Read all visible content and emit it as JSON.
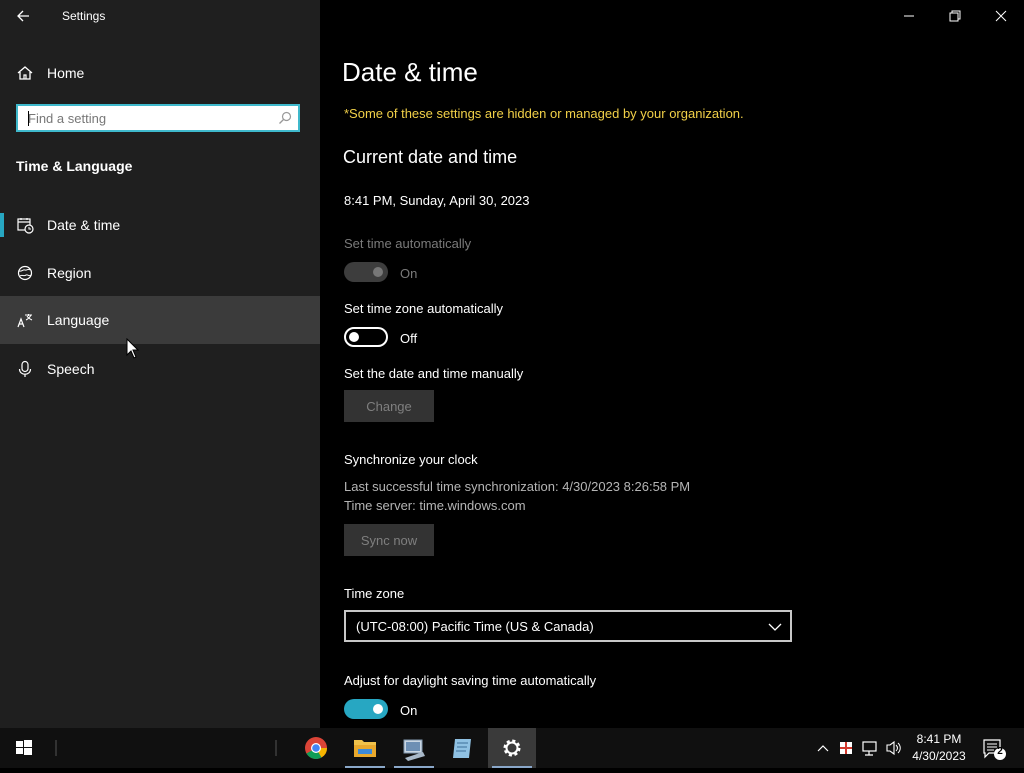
{
  "window": {
    "app_title": "Settings"
  },
  "sidebar": {
    "home_label": "Home",
    "search_placeholder": "Find a setting",
    "section_title": "Time & Language",
    "items": [
      {
        "label": "Date & time",
        "icon": "calendar-clock-icon",
        "selected": true
      },
      {
        "label": "Region",
        "icon": "globe-icon"
      },
      {
        "label": "Language",
        "icon": "language-icon"
      },
      {
        "label": "Speech",
        "icon": "microphone-icon"
      }
    ]
  },
  "main": {
    "title": "Date & time",
    "org_note": "*Some of these settings are hidden or managed by your organization.",
    "current_heading": "Current date and time",
    "current_datetime": "8:41 PM, Sunday, April 30, 2023",
    "set_time_auto": {
      "label": "Set time automatically",
      "state": "On",
      "enabled": false
    },
    "set_timezone_auto": {
      "label": "Set time zone automatically",
      "state": "Off"
    },
    "manual": {
      "label": "Set the date and time manually",
      "button": "Change"
    },
    "sync": {
      "heading": "Synchronize your clock",
      "last_sync": "Last successful time synchronization: 4/30/2023 8:26:58 PM",
      "server": "Time server: time.windows.com",
      "button": "Sync now"
    },
    "timezone": {
      "label": "Time zone",
      "value": "(UTC-08:00) Pacific Time (US & Canada)"
    },
    "dst": {
      "label": "Adjust for daylight saving time automatically",
      "state": "On"
    }
  },
  "taskbar": {
    "time": "8:41 PM",
    "date": "4/30/2023",
    "notification_count": "2",
    "apps": [
      "chrome-icon",
      "file-explorer-icon",
      "network-drive-icon",
      "notepad-icon",
      "settings-gear-icon"
    ]
  },
  "colors": {
    "accent": "#27a7c2",
    "warning_text": "#f1d048",
    "sidebar_bg": "#1f1f1f",
    "hover_bg": "#3b3b3b"
  }
}
